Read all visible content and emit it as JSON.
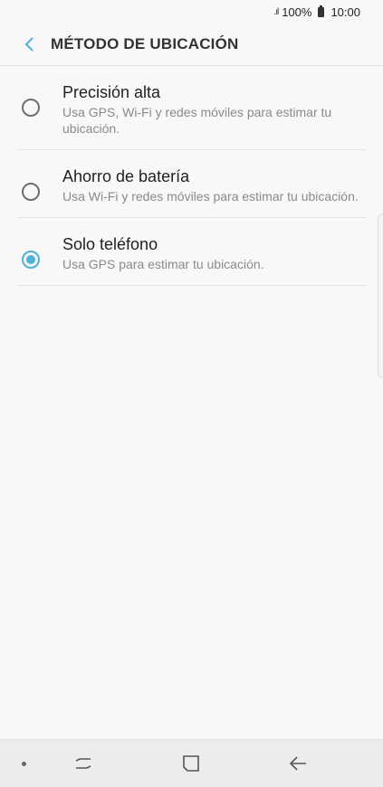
{
  "status_bar": {
    "signal": ".ıl",
    "battery_text": "100%",
    "time": "10:00"
  },
  "header": {
    "title": "MÉTODO DE UBICACIÓN",
    "back_icon": "chevron-left-icon",
    "accent_color": "#4fb2d9"
  },
  "options": [
    {
      "title": "Precisión alta",
      "description": "Usa GPS, Wi-Fi y redes móviles para estimar tu ubicación.",
      "selected": false
    },
    {
      "title": "Ahorro de batería",
      "description": "Usa Wi-Fi y redes móviles para estimar tu ubicación.",
      "selected": false
    },
    {
      "title": "Solo teléfono",
      "description": "Usa GPS para estimar tu ubicación.",
      "selected": true
    }
  ],
  "nav_bar": {
    "icons": [
      "dot-indicator-icon",
      "recent-apps-icon",
      "home-icon",
      "back-arrow-icon"
    ]
  }
}
